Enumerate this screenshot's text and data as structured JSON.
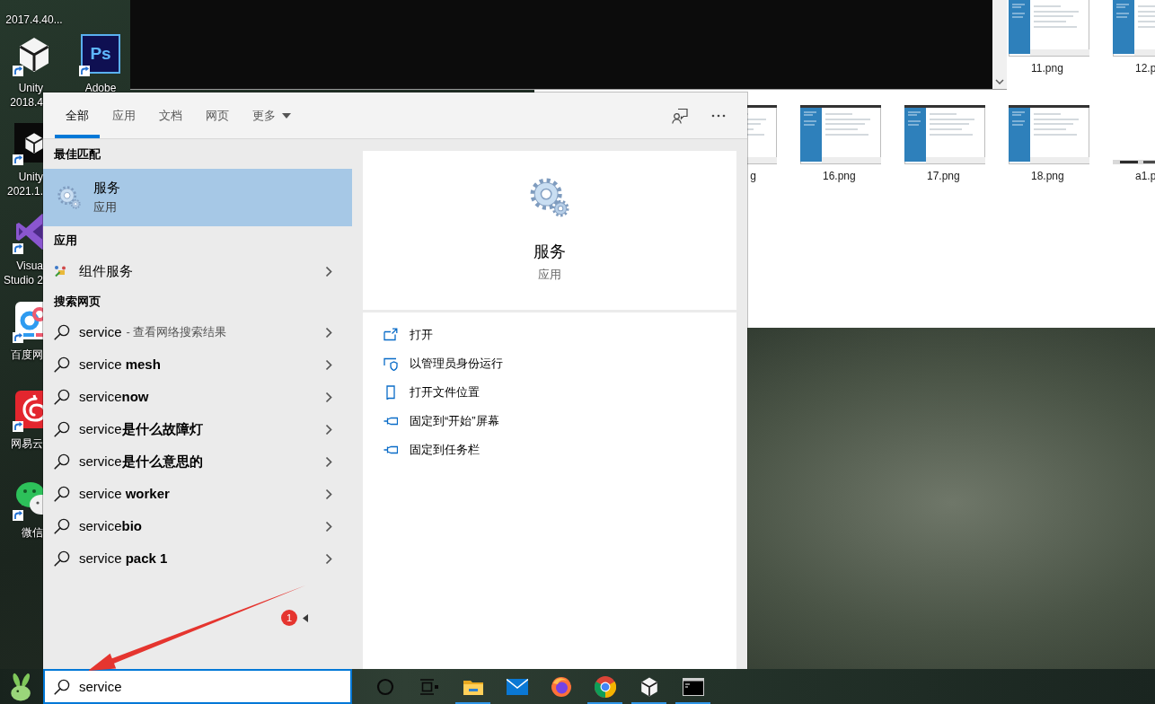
{
  "desktop": {
    "columns": [
      [
        {
          "kind": "label-only",
          "label": [
            "2017.4.40..."
          ],
          "shortcut": false
        },
        {
          "kind": "unity",
          "label": [
            "Unity",
            "2018.4"
          ],
          "shortcut": true
        },
        {
          "kind": "unity-tile",
          "label": [
            "Unity",
            "2021.1."
          ],
          "shortcut": true
        },
        {
          "kind": "visual-studio",
          "label": [
            "Visua",
            "Studio 2"
          ],
          "shortcut": true
        },
        {
          "kind": "baidu-netdisk",
          "label": [
            "百度网"
          ],
          "shortcut": true
        },
        {
          "kind": "netease-music",
          "label": [
            "网易云"
          ],
          "shortcut": true
        },
        {
          "kind": "wechat",
          "label": [
            "微信"
          ],
          "shortcut": true
        }
      ],
      [
        {
          "kind": "photoshop",
          "logo_text": "Ps",
          "label": [
            "Adobe"
          ],
          "shortcut": true
        }
      ]
    ]
  },
  "file_explorer": {
    "rows": [
      [
        "",
        "",
        "",
        {
          "kind": "screenshot",
          "label": "11.png"
        },
        {
          "kind": "screenshot",
          "label": "12.p"
        }
      ],
      [
        {
          "kind": "screenshot",
          "label": "g"
        },
        {
          "kind": "screenshot",
          "label": "16.png"
        },
        {
          "kind": "screenshot",
          "label": "17.png"
        },
        {
          "kind": "screenshot",
          "label": "18.png"
        },
        {
          "kind": "strip",
          "label": "a1.p"
        }
      ]
    ]
  },
  "search_panel": {
    "tabs": [
      {
        "label": "全部",
        "selected": true,
        "dropdown": false
      },
      {
        "label": "应用",
        "selected": false,
        "dropdown": false
      },
      {
        "label": "文档",
        "selected": false,
        "dropdown": false
      },
      {
        "label": "网页",
        "selected": false,
        "dropdown": false
      },
      {
        "label": "更多",
        "selected": false,
        "dropdown": true
      }
    ],
    "sections": [
      {
        "title": "最佳匹配",
        "items": [
          {
            "kind": "best-match",
            "title": "服务",
            "subtitle": "应用",
            "selected": true
          }
        ]
      },
      {
        "title": "应用",
        "items": [
          {
            "kind": "app",
            "title": "组件服务",
            "selected": false
          }
        ]
      },
      {
        "title": "搜索网页",
        "items": [
          {
            "kind": "web",
            "text": "service",
            "hint": "- 查看网络搜索结果",
            "selected": false
          },
          {
            "kind": "web",
            "text": "service **mesh**",
            "selected": false
          },
          {
            "kind": "web",
            "text": "service**now**",
            "selected": false
          },
          {
            "kind": "web",
            "text": "service**是什么故障灯**",
            "selected": false
          },
          {
            "kind": "web",
            "text": "service**是什么意思的**",
            "selected": false
          },
          {
            "kind": "web",
            "text": "service **worker**",
            "selected": false
          },
          {
            "kind": "web",
            "text": "service**bio**",
            "selected": false
          },
          {
            "kind": "web",
            "text": "service **pack 1**",
            "selected": false
          }
        ]
      }
    ],
    "preview": {
      "title": "服务",
      "subtitle": "应用",
      "actions": [
        {
          "kind": "open",
          "label": "打开"
        },
        {
          "kind": "run-as-admin",
          "label": "以管理员身份运行"
        },
        {
          "kind": "file-location",
          "label": "打开文件位置"
        },
        {
          "kind": "pin",
          "label": "固定到“开始”屏幕"
        },
        {
          "kind": "pin",
          "label": "固定到任务栏"
        }
      ]
    }
  },
  "annotation": {
    "badge": "1"
  },
  "taskbar": {
    "search_box": {
      "value": "service"
    },
    "buttons": [
      {
        "kind": "cortana",
        "running": false
      },
      {
        "kind": "task-view",
        "running": false
      },
      {
        "kind": "file-explorer",
        "running": true
      },
      {
        "kind": "mail",
        "running": false
      },
      {
        "kind": "firefox",
        "running": false
      },
      {
        "kind": "chrome",
        "running": true
      },
      {
        "kind": "unity",
        "running": true
      },
      {
        "kind": "terminal",
        "running": true
      }
    ]
  }
}
